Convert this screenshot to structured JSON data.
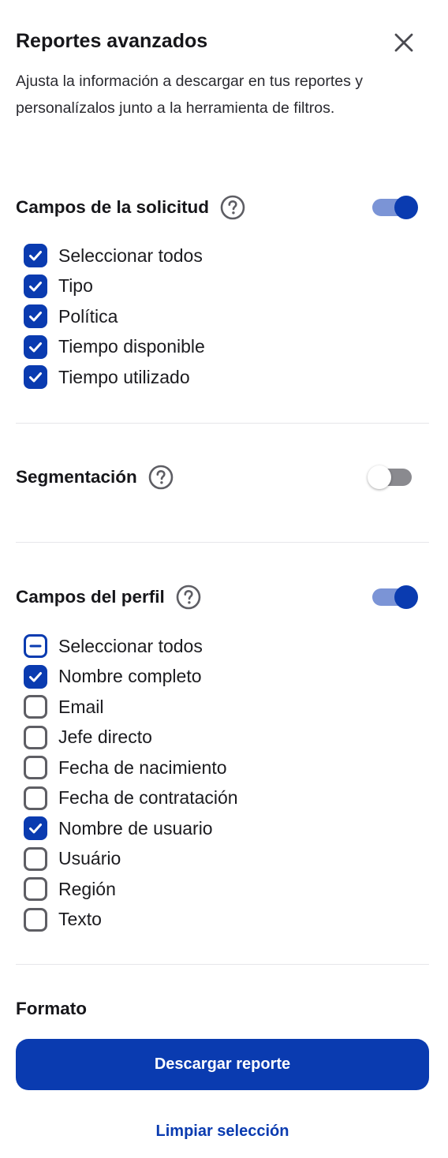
{
  "header": {
    "title": "Reportes avanzados",
    "subtitle": "Ajusta la información a descargar en tus reportes y personalízalos junto a la herramienta de filtros.",
    "close_icon": "close-icon"
  },
  "sections": {
    "request_fields": {
      "title": "Campos de la solicitud",
      "help_icon": "help-circle-icon",
      "enabled": true,
      "items": [
        {
          "label": "Seleccionar todos",
          "state": "checked"
        },
        {
          "label": "Tipo",
          "state": "checked"
        },
        {
          "label": "Política",
          "state": "checked"
        },
        {
          "label": "Tiempo disponible",
          "state": "checked"
        },
        {
          "label": "Tiempo utilizado",
          "state": "checked"
        }
      ]
    },
    "segmentation": {
      "title": "Segmentación",
      "help_icon": "help-circle-icon",
      "enabled": false
    },
    "profile_fields": {
      "title": "Campos del perfil",
      "help_icon": "help-circle-icon",
      "enabled": true,
      "items": [
        {
          "label": "Seleccionar todos",
          "state": "indeterminate"
        },
        {
          "label": "Nombre completo",
          "state": "checked"
        },
        {
          "label": "Email",
          "state": "unchecked"
        },
        {
          "label": "Jefe directo",
          "state": "unchecked"
        },
        {
          "label": "Fecha de nacimiento",
          "state": "unchecked"
        },
        {
          "label": "Fecha de contratación",
          "state": "unchecked"
        },
        {
          "label": "Nombre de usuario",
          "state": "checked"
        },
        {
          "label": "Usuário",
          "state": "unchecked"
        },
        {
          "label": "Región",
          "state": "unchecked"
        },
        {
          "label": "Texto",
          "state": "unchecked"
        }
      ]
    }
  },
  "format": {
    "label": "Formato"
  },
  "actions": {
    "download_label": "Descargar reporte",
    "clear_label": "Limpiar selección"
  },
  "colors": {
    "accent": "#0A3BB0",
    "toggle_track_on": "#7B94D6",
    "toggle_track_off": "#8A8A8F",
    "divider": "#E6E6EA"
  }
}
